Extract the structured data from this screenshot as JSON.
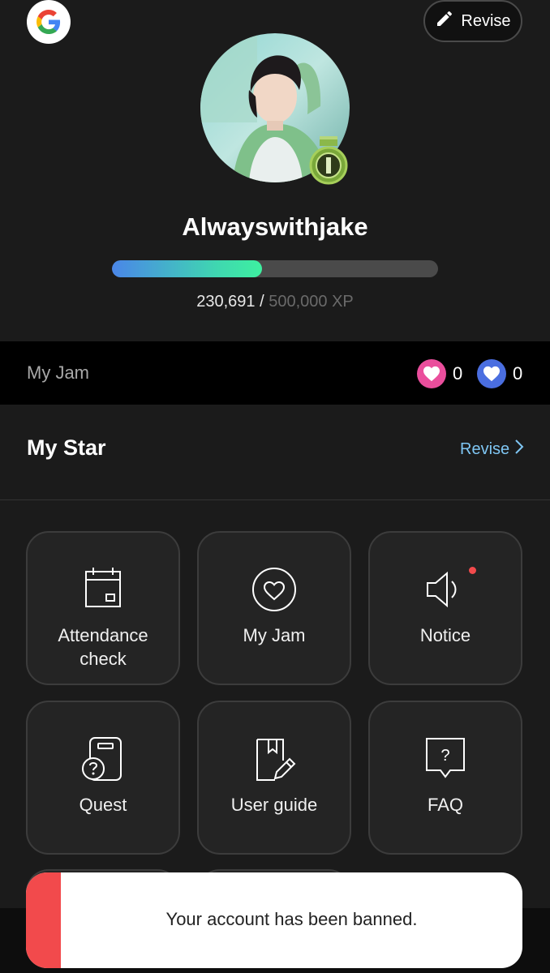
{
  "profile": {
    "revise_label": "Revise",
    "username": "Alwayswithjake",
    "xp_current": "230,691",
    "xp_separator": " / ",
    "xp_total": "500,000 XP",
    "xp_progress_fraction": 0.46
  },
  "jam": {
    "label": "My Jam",
    "pink_count": "0",
    "blue_count": "0"
  },
  "my_star": {
    "title": "My Star",
    "revise_label": "Revise"
  },
  "menu": {
    "attendance": {
      "line1": "Attendance",
      "line2": "check"
    },
    "my_jam": "My Jam",
    "notice": "Notice",
    "quest": "Quest",
    "user_guide": "User guide",
    "faq": "FAQ"
  },
  "toast": {
    "message": "Your account has been banned."
  },
  "colors": {
    "accent_blue_link": "#7fc6f3",
    "pink_heart": "#ea4e9c",
    "blue_heart": "#4a6ee0",
    "toast_accent": "#f24a4c",
    "notice_dot": "#f24a4c"
  }
}
